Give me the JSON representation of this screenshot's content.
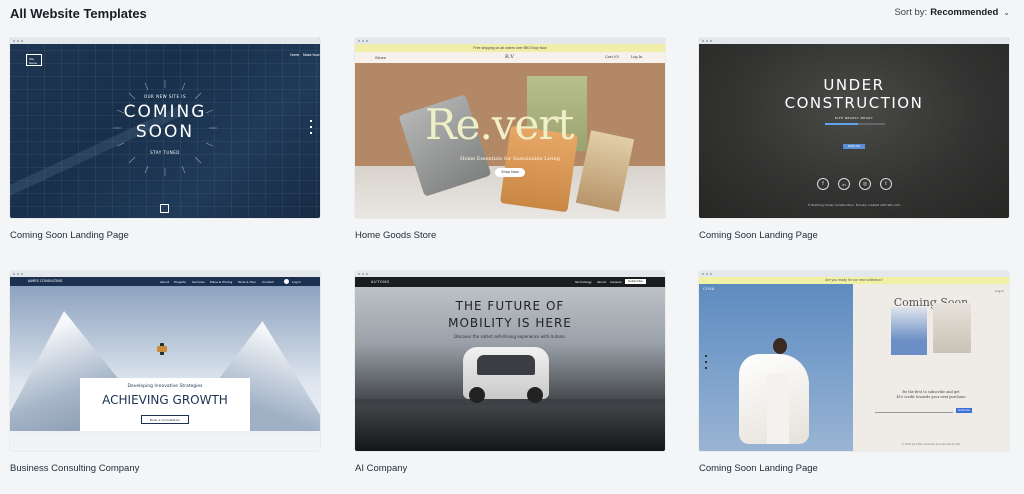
{
  "header": {
    "title": "All Website Templates",
    "sort_label": "Sort by:",
    "sort_value": "Recommended"
  },
  "templates": [
    {
      "name": "Coming Soon Landing Page",
      "preview": {
        "logo": "Site Name",
        "nav": [
          "Home",
          "Make Now"
        ],
        "eyebrow": "OUR NEW SITE IS",
        "headline_1": "COMING",
        "headline_2": "SOON",
        "sub": "STAY TUNED"
      }
    },
    {
      "name": "Home Goods Store",
      "preview": {
        "banner": "Free shipping on all orders over $50 Shop Now",
        "nav_left": "Store",
        "logo": "R.V",
        "nav_right": [
          "Log In"
        ],
        "nav_cart": "Cart (0)",
        "headline": "Re.vert",
        "tagline": "Home Essentials for Sustainable Living",
        "cta": "Shop Now"
      }
    },
    {
      "name": "Coming Soon Landing Page",
      "preview": {
        "headline_1": "UNDER",
        "headline_2": "CONSTRUCTION",
        "sub": "SITE NEARLY READY",
        "cta": "Notify Me",
        "social": [
          "f",
          "in",
          "◎",
          "t"
        ],
        "footer": "© Building Under Construction. Proudly created with Wix.com"
      }
    },
    {
      "name": "Business Consulting Company",
      "preview": {
        "logo": "JAMES CONSULTING",
        "nav": [
          "About",
          "Projects",
          "Services",
          "Plans & Pricing",
          "Tools & Tips",
          "Contact"
        ],
        "login": "Log In",
        "eyebrow": "Developing Innovative Strategies",
        "headline": "ACHIEVING GROWTH",
        "cta": "Book A Consultation"
      }
    },
    {
      "name": "AI Company",
      "preview": {
        "logo": "AUTONO",
        "nav": [
          "Technology",
          "About",
          "Careers"
        ],
        "nav_cta": "Subscribe",
        "headline_1": "THE FUTURE OF",
        "headline_2": "MOBILITY IS HERE",
        "sub": "Discover the safest self-driving experience with Autono."
      }
    },
    {
      "name": "Coming Soon Landing Page",
      "preview": {
        "banner": "Are you ready for our new collection?",
        "logo": "COVA",
        "login": "Log In",
        "headline": "Coming Soon",
        "copy_1": "Be the first to subscribe and get",
        "copy_2": "$10 credit towards your next purchase",
        "cta": "Subscribe",
        "footer": "© 2035 by COVA. Powered and secured by Wix"
      }
    }
  ],
  "colors": {
    "page_bg": "#f3f5f7",
    "text": "#20303c",
    "navy": "#1c3152"
  }
}
